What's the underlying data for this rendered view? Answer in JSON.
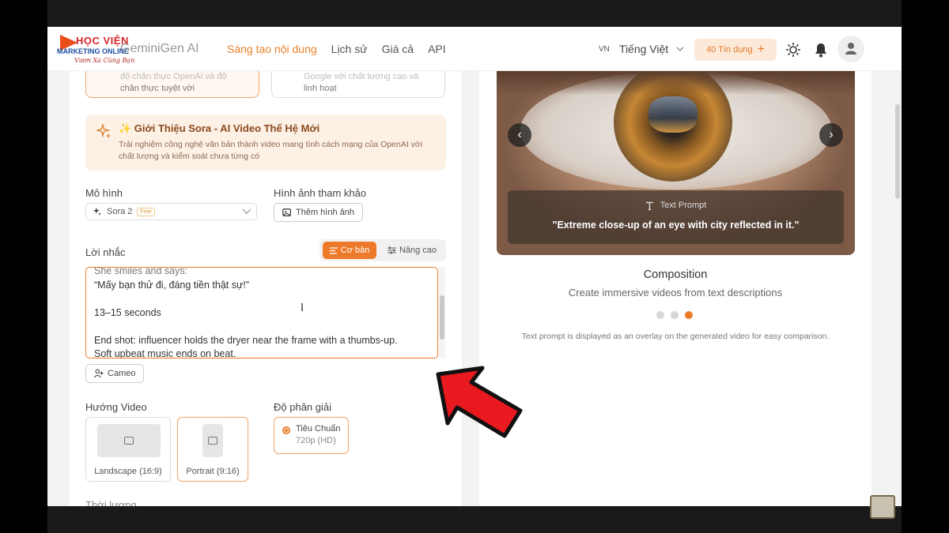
{
  "brand": {
    "logo_line1": "HỌC VIỆN",
    "logo_line2": "MARKETING ONLINE",
    "logo_line3": "Vươn Xa Cùng Bạn",
    "name": "GeminiGen AI",
    "accent": "#ec7a2a"
  },
  "nav": {
    "items": [
      "Sáng tạo nội dung",
      "Lịch sử",
      "Giá cả",
      "API"
    ],
    "active_index": 0
  },
  "header": {
    "lang_code": "VN",
    "lang_label": "Tiếng Việt",
    "credit_label": "40 Tín dụng",
    "credit_plus": "+",
    "icons": [
      "sun-icon",
      "bell-icon",
      "user-icon"
    ]
  },
  "top_cards": {
    "left_text": "chân thực tuyệt vời",
    "left_ghost": "độ chân thực OpenAI và độ",
    "right_text": "linh hoạt",
    "right_ghost": "Google với chất lượng cao và"
  },
  "sora_intro": {
    "title": "✨ Giới Thiệu Sora - AI Video Thế Hệ Mới",
    "desc": "Trải nghiệm công nghệ văn bản thành video mang tính cách mạng của OpenAI với chất lượng và kiểm soát chưa từng có"
  },
  "model": {
    "label": "Mô hình",
    "selected": "Sora 2",
    "badge": "Free"
  },
  "reference": {
    "label": "Hình ảnh tham khảo",
    "button": "Thêm hình ảnh"
  },
  "prompt": {
    "label": "Lời nhắc",
    "mode_basic": "Cơ bản",
    "mode_advanced": "Nâng cao",
    "lines_top": "She smiles and says:",
    "line_quote": "“Mấy bạn thử đi, đáng tiền thật sự!”",
    "line_duration": "13–15 seconds",
    "line_end1": "End shot: influencer holds the dryer near the frame with a thumbs-up.",
    "line_end2": "Soft upbeat music ends on beat."
  },
  "cameo": {
    "button": "Cameo"
  },
  "orientation": {
    "label": "Hướng Video",
    "options": [
      "Landscape (16:9)",
      "Portrait (9:16)"
    ],
    "selected_index": 1
  },
  "resolution": {
    "label": "Độ phân giải",
    "option_name": "Tiêu Chuẩn",
    "option_detail": "720p (HD)"
  },
  "duration": {
    "label": "Thời lượng"
  },
  "preview": {
    "overlay_head": "Text Prompt",
    "overlay_text": "\"Extreme close-up of an eye with city reflected in it.\"",
    "title": "Composition",
    "subtitle": "Create immersive videos from text descriptions",
    "note": "Text prompt is displayed as an overlay on the generated video for easy comparison.",
    "dot_count": 3,
    "active_dot": 2,
    "prev": "‹",
    "next": "›"
  }
}
